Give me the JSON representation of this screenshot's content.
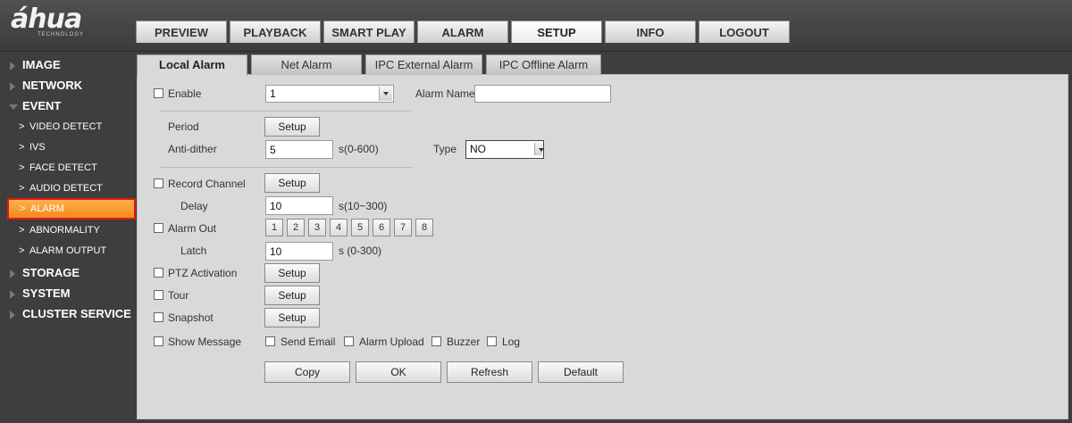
{
  "logo": {
    "main": "áhua",
    "sub": "TECHNOLOGY"
  },
  "nav": {
    "tabs": [
      {
        "label": "PREVIEW",
        "active": false
      },
      {
        "label": "PLAYBACK",
        "active": false
      },
      {
        "label": "SMART PLAY",
        "active": false
      },
      {
        "label": "ALARM",
        "active": false
      },
      {
        "label": "SETUP",
        "active": true
      },
      {
        "label": "INFO",
        "active": false
      },
      {
        "label": "LOGOUT",
        "active": false
      }
    ]
  },
  "sidebar": {
    "items": [
      {
        "label": "IMAGE",
        "level": "top",
        "expanded": false
      },
      {
        "label": "NETWORK",
        "level": "top",
        "expanded": false
      },
      {
        "label": "EVENT",
        "level": "top",
        "expanded": true
      },
      {
        "label": "VIDEO DETECT",
        "level": "sub"
      },
      {
        "label": "IVS",
        "level": "sub"
      },
      {
        "label": "FACE DETECT",
        "level": "sub"
      },
      {
        "label": "AUDIO DETECT",
        "level": "sub"
      },
      {
        "label": "ALARM",
        "level": "sub",
        "selected": true
      },
      {
        "label": "ABNORMALITY",
        "level": "sub"
      },
      {
        "label": "ALARM OUTPUT",
        "level": "sub"
      },
      {
        "label": "STORAGE",
        "level": "top",
        "expanded": false
      },
      {
        "label": "SYSTEM",
        "level": "top",
        "expanded": false
      },
      {
        "label": "CLUSTER SERVICE",
        "level": "top",
        "expanded": false
      }
    ]
  },
  "subtabs": [
    {
      "label": "Local Alarm",
      "active": true
    },
    {
      "label": "Net Alarm",
      "active": false
    },
    {
      "label": "IPC External Alarm",
      "active": false
    },
    {
      "label": "IPC Offline Alarm",
      "active": false
    }
  ],
  "form": {
    "enable": {
      "label": "Enable",
      "checked": false
    },
    "alarm_select": {
      "value": "1"
    },
    "alarm_name": {
      "label": "Alarm Name",
      "value": ""
    },
    "period": {
      "label": "Period",
      "button": "Setup"
    },
    "anti_dither": {
      "label": "Anti-dither",
      "value": "5",
      "unit": "s(0-600)"
    },
    "type": {
      "label": "Type",
      "value": "NO"
    },
    "record_channel": {
      "label": "Record Channel",
      "checked": false,
      "button": "Setup"
    },
    "delay": {
      "label": "Delay",
      "value": "10",
      "unit": "s(10~300)"
    },
    "alarm_out": {
      "label": "Alarm Out",
      "checked": false,
      "channels": [
        "1",
        "2",
        "3",
        "4",
        "5",
        "6",
        "7",
        "8"
      ]
    },
    "latch": {
      "label": "Latch",
      "value": "10",
      "unit": "s (0-300)"
    },
    "ptz_activation": {
      "label": "PTZ Activation",
      "checked": false,
      "button": "Setup"
    },
    "tour": {
      "label": "Tour",
      "checked": false,
      "button": "Setup"
    },
    "snapshot": {
      "label": "Snapshot",
      "checked": false,
      "button": "Setup"
    },
    "show_message": {
      "label": "Show Message",
      "checked": false
    },
    "send_email": {
      "label": "Send Email",
      "checked": false
    },
    "alarm_upload": {
      "label": "Alarm Upload",
      "checked": false
    },
    "buzzer": {
      "label": "Buzzer",
      "checked": false
    },
    "log": {
      "label": "Log",
      "checked": false
    }
  },
  "actions": {
    "copy": "Copy",
    "ok": "OK",
    "refresh": "Refresh",
    "default": "Default"
  },
  "colors": {
    "selected_bg": "#f48a1e",
    "selected_border": "#e01818",
    "content_bg": "#d9d9d9",
    "sidebar_bg": "#3e3e3e"
  }
}
